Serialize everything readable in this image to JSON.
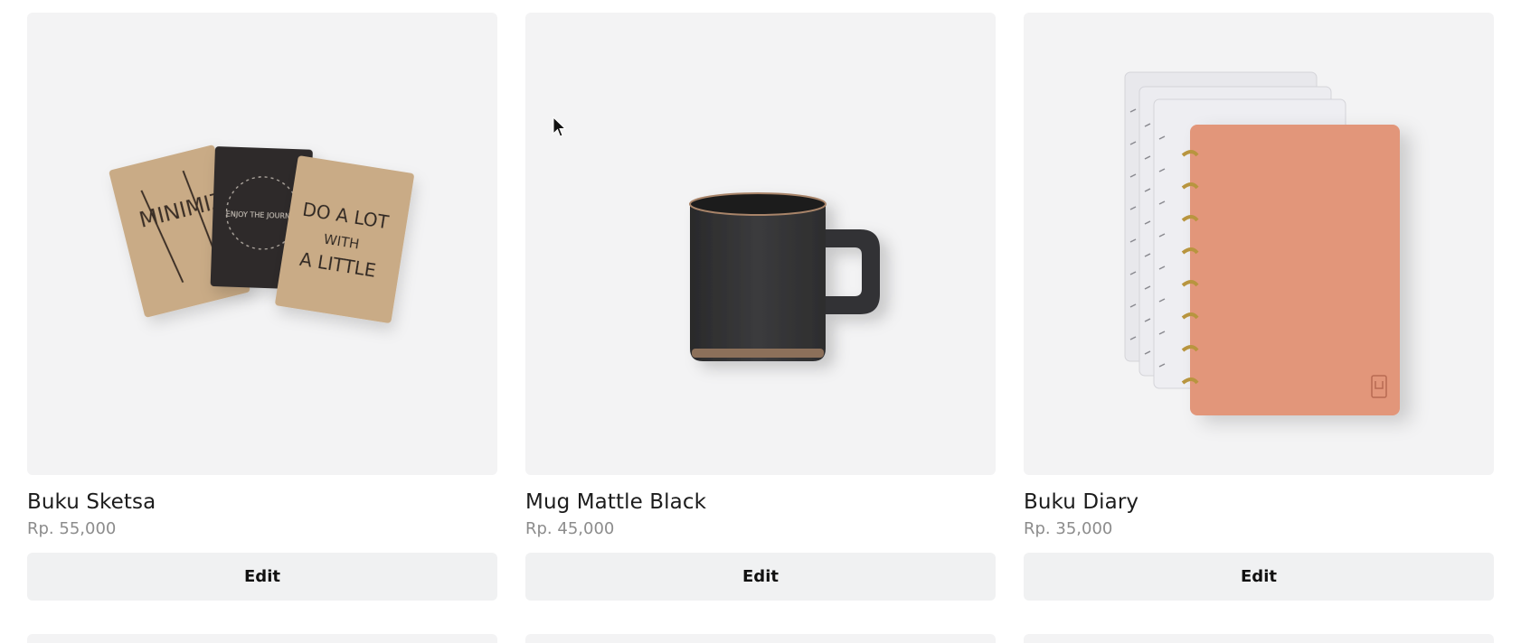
{
  "products": [
    {
      "name": "Buku Sketsa",
      "price": "Rp. 55,000",
      "edit_label": "Edit",
      "image_desc_icon": "sketchbook-image"
    },
    {
      "name": "Mug Mattle Black",
      "price": "Rp. 45,000",
      "edit_label": "Edit",
      "image_desc_icon": "mug-image"
    },
    {
      "name": "Buku Diary",
      "price": "Rp. 35,000",
      "edit_label": "Edit",
      "image_desc_icon": "diary-image"
    }
  ],
  "images": {
    "sketchbook_text": {
      "left": "MINIMIZE",
      "middle": "ENJOY THE JOURNEY",
      "right_line1": "DO A LOT",
      "right_line2": "WITH",
      "right_line3": "A LITTLE"
    }
  },
  "colors": {
    "card_bg": "#f3f3f4",
    "button_bg": "#f0f1f2",
    "price": "#8c8c8c",
    "name": "#1c1c1c"
  }
}
